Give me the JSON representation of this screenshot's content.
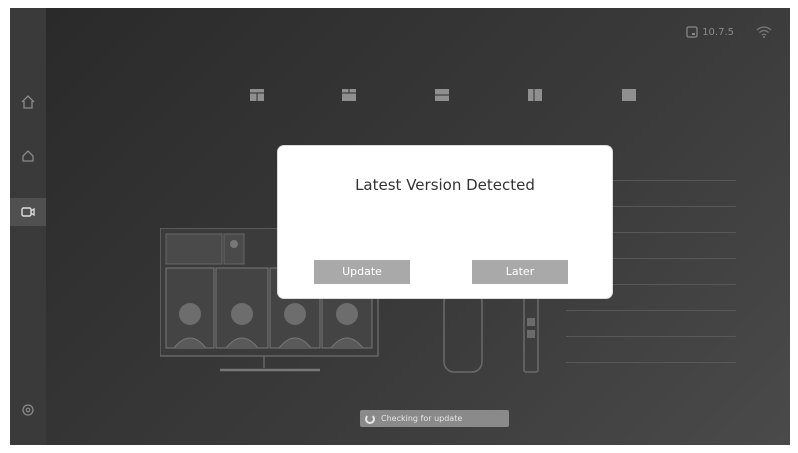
{
  "status": {
    "ip": "10.7.5",
    "icons": [
      "display-icon",
      "wifi-icon"
    ]
  },
  "sidebar": {
    "items": [
      "home-icon",
      "meeting-icon",
      "camera-icon",
      "settings-icon"
    ],
    "active": "camera-icon"
  },
  "layouts": [
    "layout-grid-icon",
    "layout-top-split-icon",
    "layout-horizontal-split-icon",
    "layout-vertical-split-icon",
    "layout-full-icon"
  ],
  "dialog": {
    "title": "Latest Version Detected",
    "update_label": "Update",
    "later_label": "Later"
  },
  "update_status": {
    "label": "Checking for update"
  },
  "colors": {
    "background": "#2b2b2b",
    "sidebar": "#3a3a3a",
    "dialog": "#ffffff",
    "button": "#a9a9a9"
  }
}
